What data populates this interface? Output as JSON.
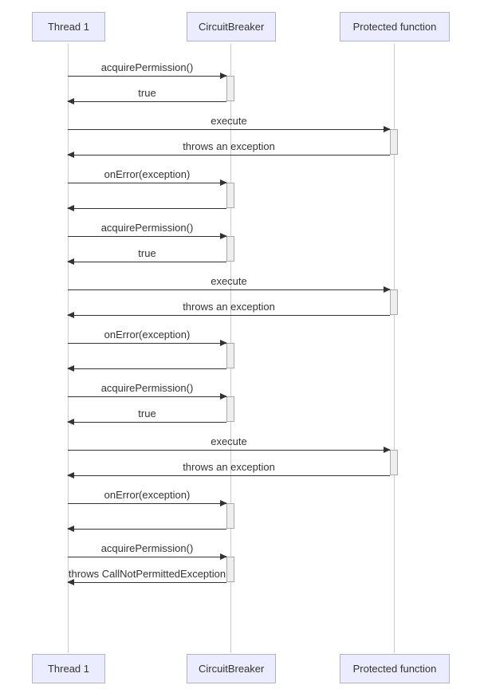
{
  "participants": {
    "thread": "Thread 1",
    "breaker": "CircuitBreaker",
    "func": "Protected function"
  },
  "messages": {
    "m1": "acquirePermission()",
    "m2": "true",
    "m3": "execute",
    "m4": "throws an exception",
    "m5": "onError(exception)",
    "m6": "",
    "m7": "acquirePermission()",
    "m8": "true",
    "m9": "execute",
    "m10": "throws an exception",
    "m11": "onError(exception)",
    "m12": "",
    "m13": "acquirePermission()",
    "m14": "true",
    "m15": "execute",
    "m16": "throws an exception",
    "m17": "onError(exception)",
    "m18": "",
    "m19": "acquirePermission()",
    "m20": "throws CallNotPermittedException"
  },
  "chart_data": {
    "type": "sequence-diagram",
    "participants": [
      "Thread 1",
      "CircuitBreaker",
      "Protected function"
    ],
    "events": [
      {
        "from": "Thread 1",
        "to": "CircuitBreaker",
        "label": "acquirePermission()"
      },
      {
        "from": "CircuitBreaker",
        "to": "Thread 1",
        "label": "true"
      },
      {
        "from": "Thread 1",
        "to": "Protected function",
        "label": "execute"
      },
      {
        "from": "Protected function",
        "to": "Thread 1",
        "label": "throws an exception"
      },
      {
        "from": "Thread 1",
        "to": "CircuitBreaker",
        "label": "onError(exception)"
      },
      {
        "from": "CircuitBreaker",
        "to": "Thread 1",
        "label": ""
      },
      {
        "from": "Thread 1",
        "to": "CircuitBreaker",
        "label": "acquirePermission()"
      },
      {
        "from": "CircuitBreaker",
        "to": "Thread 1",
        "label": "true"
      },
      {
        "from": "Thread 1",
        "to": "Protected function",
        "label": "execute"
      },
      {
        "from": "Protected function",
        "to": "Thread 1",
        "label": "throws an exception"
      },
      {
        "from": "Thread 1",
        "to": "CircuitBreaker",
        "label": "onError(exception)"
      },
      {
        "from": "CircuitBreaker",
        "to": "Thread 1",
        "label": ""
      },
      {
        "from": "Thread 1",
        "to": "CircuitBreaker",
        "label": "acquirePermission()"
      },
      {
        "from": "CircuitBreaker",
        "to": "Thread 1",
        "label": "true"
      },
      {
        "from": "Thread 1",
        "to": "Protected function",
        "label": "execute"
      },
      {
        "from": "Protected function",
        "to": "Thread 1",
        "label": "throws an exception"
      },
      {
        "from": "Thread 1",
        "to": "CircuitBreaker",
        "label": "onError(exception)"
      },
      {
        "from": "CircuitBreaker",
        "to": "Thread 1",
        "label": ""
      },
      {
        "from": "Thread 1",
        "to": "CircuitBreaker",
        "label": "acquirePermission()"
      },
      {
        "from": "CircuitBreaker",
        "to": "Thread 1",
        "label": "throws CallNotPermittedException"
      }
    ]
  }
}
